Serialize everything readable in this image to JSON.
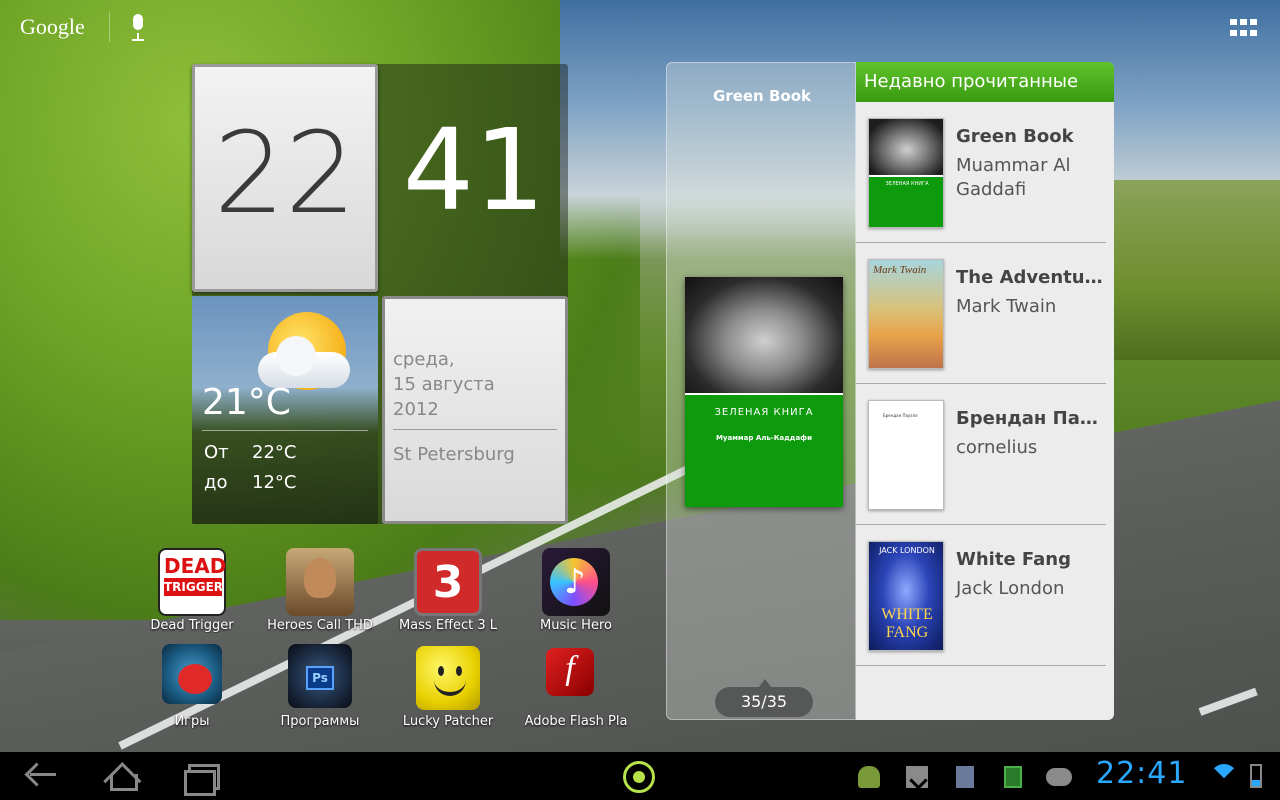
{
  "topbar": {
    "search_brand": "Google",
    "mic_icon": "mic-icon",
    "apps_icon": "all-apps-grid-icon"
  },
  "clock": {
    "hours": "22",
    "minutes": "41"
  },
  "weather": {
    "icon": "partly-cloudy-sun-icon",
    "temp_now": "21°C",
    "from_label": "От",
    "from_value": "22°C",
    "to_label": "до",
    "to_value": "12°C"
  },
  "calendar": {
    "weekday": "среда,",
    "date": "15 августа",
    "year": "2012",
    "city": "St Petersburg"
  },
  "reader": {
    "current_title": "Green Book",
    "cover_title": "ЗЕЛЕНАЯ КНИГА",
    "cover_author": "Муаммар Аль-Каддафи",
    "page_counter": "35/35",
    "recent_header": "Недавно прочитанные",
    "books": [
      {
        "title": "Green Book",
        "author": "Muammar Al Gaddafi"
      },
      {
        "title": "The Adventures of Tom Sawyer",
        "author": "Mark Twain",
        "thumb_text": "Mark Twain"
      },
      {
        "title": "Брендан Пауэлл",
        "author": "cornelius"
      },
      {
        "title": "White Fang",
        "author": "Jack London",
        "thumb_top": "JACK LONDON",
        "thumb_big": "WHITE FANG"
      }
    ]
  },
  "apps": [
    {
      "label": "Dead Trigger",
      "icon_top": "DEAD",
      "icon_bottom": "TRIGGER"
    },
    {
      "label": "Heroes Call THD"
    },
    {
      "label": "Mass Effect 3 L",
      "icon_text": "3"
    },
    {
      "label": "Music Hero"
    },
    {
      "label": "Игры"
    },
    {
      "label": "Программы",
      "icon_text": "Ps"
    },
    {
      "label": "Lucky Patcher"
    },
    {
      "label": "Adobe Flash Pla",
      "icon_text": "f"
    }
  ],
  "systembar": {
    "time": "22:41",
    "accent_color": "#2aa8ff",
    "nav": [
      "back-icon",
      "home-icon",
      "recent-apps-icon"
    ],
    "tray": [
      "android-debug-icon",
      "download-icon",
      "sd-card-icon",
      "book-icon",
      "steam-icon",
      "wifi-icon",
      "battery-icon"
    ]
  }
}
